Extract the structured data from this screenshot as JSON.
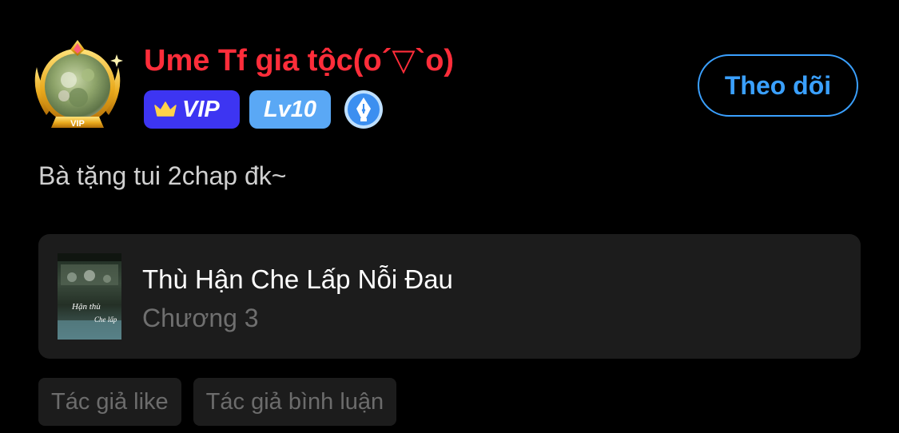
{
  "user": {
    "name": "Ume Tf gia tộc(o´▽`o)",
    "name_color": "#ff2d3a",
    "avatar_frame_label": "VIP"
  },
  "badges": {
    "vip_label": "VIP",
    "vip_color": "#3d35f2",
    "crown_color": "#ffd24a",
    "level_label": "Lv10",
    "level_color": "#5aa8f5",
    "creator_icon": "pen-nib-icon",
    "creator_color": "#3c8ff0"
  },
  "follow_button": {
    "label": "Theo dõi",
    "color": "#3aa0ff"
  },
  "comment": {
    "text": "Bà tặng tui 2chap đk~"
  },
  "book": {
    "title": "Thù Hận Che Lấp Nỗi Đau",
    "chapter": "Chương 3",
    "cover_text_line1": "Hận thù",
    "cover_text_line2": "Che lấp"
  },
  "tags": [
    {
      "label": "Tác giả like"
    },
    {
      "label": "Tác giả bình luận"
    }
  ]
}
